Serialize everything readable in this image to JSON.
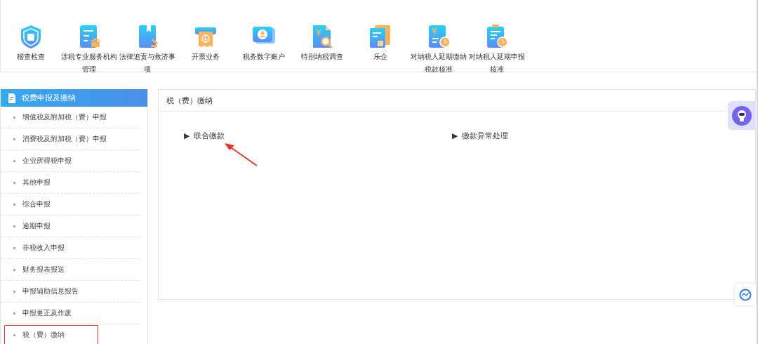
{
  "toolbar": {
    "items": [
      {
        "label": "稽查检查"
      },
      {
        "label": "涉税专业服务机构管理"
      },
      {
        "label": "法律追责与救济事项"
      },
      {
        "label": "开票业务"
      },
      {
        "label": "税务数字账户"
      },
      {
        "label": "特别纳税调查"
      },
      {
        "label": "乐企"
      },
      {
        "label": "对纳税人延期缴纳税款核准"
      },
      {
        "label": "对纳税人延期申报核准"
      }
    ]
  },
  "sidebar": {
    "title": "税费申报及缴纳",
    "items": [
      {
        "label": "增值税及附加税（费）申报",
        "marked": false
      },
      {
        "label": "消费税及附加税（费）申报",
        "marked": false
      },
      {
        "label": "企业所得税申报",
        "marked": false
      },
      {
        "label": "其他申报",
        "marked": false
      },
      {
        "label": "综合申报",
        "marked": false
      },
      {
        "label": "逾期申报",
        "marked": false
      },
      {
        "label": "非税收入申报",
        "marked": false
      },
      {
        "label": "财务报表报送",
        "marked": false
      },
      {
        "label": "申报辅助信息报告",
        "marked": false
      },
      {
        "label": "申报更正及作废",
        "marked": false
      },
      {
        "label": "税（费）缴纳",
        "marked": true
      }
    ]
  },
  "panel": {
    "title": "税（费）缴纳",
    "pointer_arrow": true,
    "links": [
      {
        "marker": "▶",
        "label": "联合缴款"
      },
      {
        "marker": "▶",
        "label": "缴款异常处理"
      }
    ]
  }
}
